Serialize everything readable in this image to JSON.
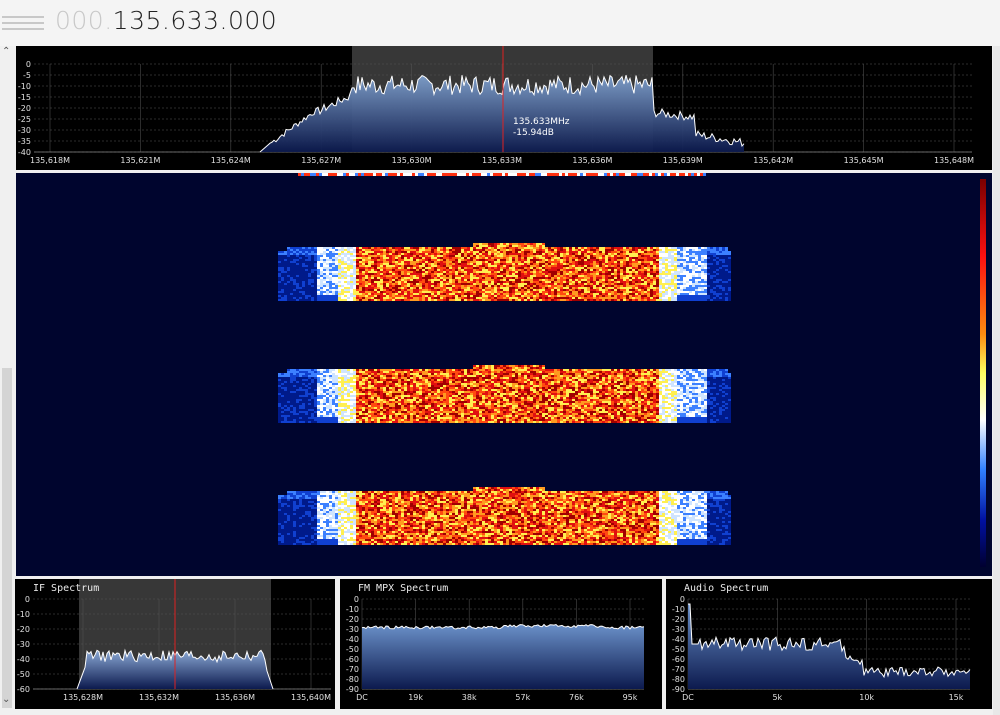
{
  "header": {
    "frequency_dim": "000.",
    "frequency_main": "135.633.000"
  },
  "main_spectrum": {
    "y_ticks": [
      "0",
      "-5",
      "-10",
      "-15",
      "-20",
      "-25",
      "-30",
      "-35",
      "-40"
    ],
    "x_ticks": [
      "135,618M",
      "135,621M",
      "135,624M",
      "135,627M",
      "135,630M",
      "135,633M",
      "135,636M",
      "135,639M",
      "135,642M",
      "135,645M",
      "135,648M"
    ],
    "readout_freq": "135.633MHz",
    "readout_db": "-15.94dB"
  },
  "if_spectrum": {
    "title": "IF Spectrum",
    "y_ticks": [
      "0",
      "-10",
      "-20",
      "-30",
      "-40",
      "-50",
      "-60"
    ],
    "x_ticks": [
      "135,628M",
      "135,632M",
      "135,636M",
      "135,640M"
    ]
  },
  "mpx_spectrum": {
    "title": "FM MPX Spectrum",
    "y_ticks": [
      "0",
      "-10",
      "-20",
      "-30",
      "-40",
      "-50",
      "-60",
      "-70",
      "-80",
      "-90"
    ],
    "x_ticks": [
      "DC",
      "19k",
      "38k",
      "57k",
      "76k",
      "95k"
    ]
  },
  "audio_spectrum": {
    "title": "Audio Spectrum",
    "y_ticks": [
      "0",
      "-10",
      "-20",
      "-30",
      "-40",
      "-50",
      "-60",
      "-70",
      "-80",
      "-90"
    ],
    "x_ticks": [
      "DC",
      "5k",
      "10k",
      "15k"
    ]
  },
  "colors": {
    "passband": "#555555",
    "tuning_line": "#dd2222",
    "trace": "#ffffff",
    "fill_top": "#7fa0cc",
    "fill_bottom": "#0c1a4e",
    "waterfall_bg": "#00052e"
  }
}
